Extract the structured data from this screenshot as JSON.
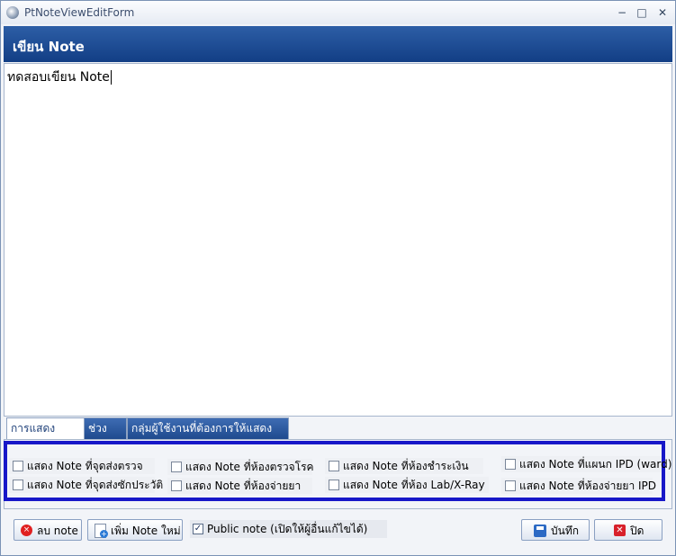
{
  "window": {
    "title": "PtNoteViewEditForm",
    "minimize_glyph": "−",
    "maximize_glyph": "□",
    "close_glyph": "✕"
  },
  "header": {
    "title": "เขียน Note"
  },
  "editor": {
    "content": "ทดสอบเขียน Note"
  },
  "tabs": [
    {
      "label": "การแสดง Note"
    },
    {
      "label": "ช่วงเวลา"
    },
    {
      "label": "กลุ่มผู้ใช้งานที่ต้องการให้แสดง Note"
    }
  ],
  "options": [
    {
      "label": "แสดง Note ที่จุดส่งตรวจ"
    },
    {
      "label": "แสดง Note ที่จุดส่งซักประวัติ"
    },
    {
      "label": "แสดง Note ที่ห้องตรวจโรค"
    },
    {
      "label": "แสดง Note ที่ห้องจ่ายยา"
    },
    {
      "label": "แสดง Note ที่ห้องชำระเงิน"
    },
    {
      "label": "แสดง Note ที่ห้อง Lab/X-Ray"
    },
    {
      "label": "แสดง Note ที่แผนก IPD (ward)"
    },
    {
      "label": "แสดง Note ที่ห้องจ่ายยา IPD"
    }
  ],
  "footer": {
    "delete_label": "ลบ note",
    "add_label": "เพิ่ม Note ใหม่",
    "public_label": "Public note (เปิดให้ผู้อื่นแก้ไขได้)",
    "public_check": "✓",
    "save_label": "บันทึก",
    "close_label": "ปิด",
    "delete_icon": "×",
    "add_icon": "+",
    "close_icon": "✕"
  },
  "colors": {
    "header_band": "#123e85",
    "options_frame": "#1717c8",
    "tab_inactive": "#1f4a8e"
  }
}
